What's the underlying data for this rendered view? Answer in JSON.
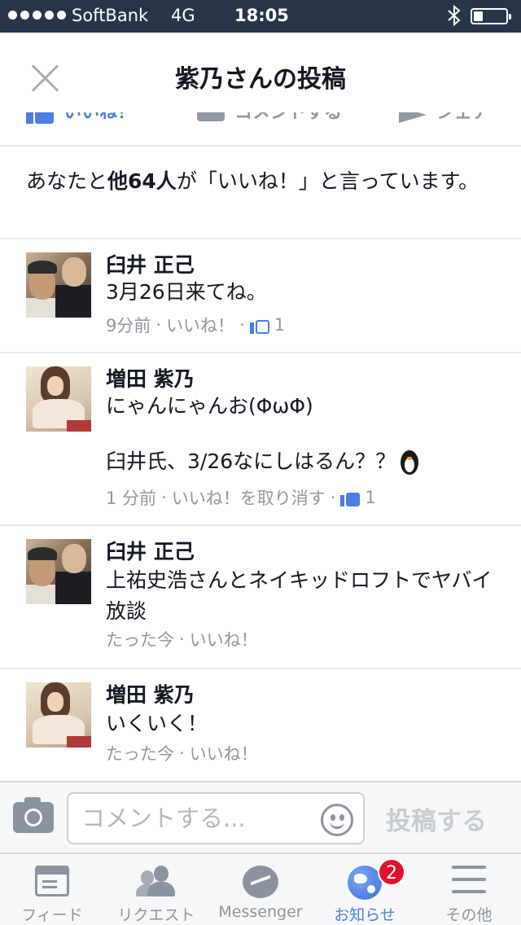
{
  "status_bar": {
    "carrier": "SoftBank",
    "network": "4G",
    "time": "18:05",
    "battery_level": 0.3
  },
  "header": {
    "title": "紫乃さんの投稿",
    "close_icon": "close-icon"
  },
  "actions": {
    "like_label": "いいね！",
    "comment_label": "コメントする",
    "share_label": "シェア"
  },
  "likes_summary": {
    "prefix": "あなたと",
    "others": "他64人",
    "suffix": "が「いいね！」と言っています。"
  },
  "comments": [
    {
      "name": "臼井 正己",
      "text": "3月26日来てね。",
      "time": "9分前",
      "sep1": "·",
      "action": "いいね！",
      "sep2": "·",
      "likes": "1"
    },
    {
      "name": "増田 紫乃",
      "text_line1": "にゃんにゃんお(ΦωΦ)",
      "text_line2": "臼井氏、3/26なにしはるん？？",
      "emoji": "penguin-icon",
      "time": "1 分前",
      "sep1": "·",
      "action": "いいね！を取り消す",
      "sep2": "·",
      "likes": "1"
    },
    {
      "name": "臼井 正己",
      "text": "上祐史浩さんとネイキッドロフトでヤバイ放談",
      "time": "たった今",
      "sep1": "·",
      "action": "いいね！"
    },
    {
      "name": "増田 紫乃",
      "text": "いくいく！",
      "time": "たった今",
      "sep1": "·",
      "action": "いいね！"
    }
  ],
  "composer": {
    "placeholder": "コメントする...",
    "post_label": "投稿する"
  },
  "tabs": [
    {
      "label": "フィード",
      "icon": "feed-icon"
    },
    {
      "label": "リクエスト",
      "icon": "friend-requests-icon"
    },
    {
      "label": "Messenger",
      "icon": "messenger-icon"
    },
    {
      "label": "お知らせ",
      "icon": "globe-icon",
      "badge": "2",
      "active": true
    },
    {
      "label": "その他",
      "icon": "menu-icon"
    }
  ],
  "colors": {
    "status_bar_bg": "#2a3448",
    "accent": "#4e7de6",
    "muted_text": "#9197a3",
    "badge": "#e3122c"
  }
}
